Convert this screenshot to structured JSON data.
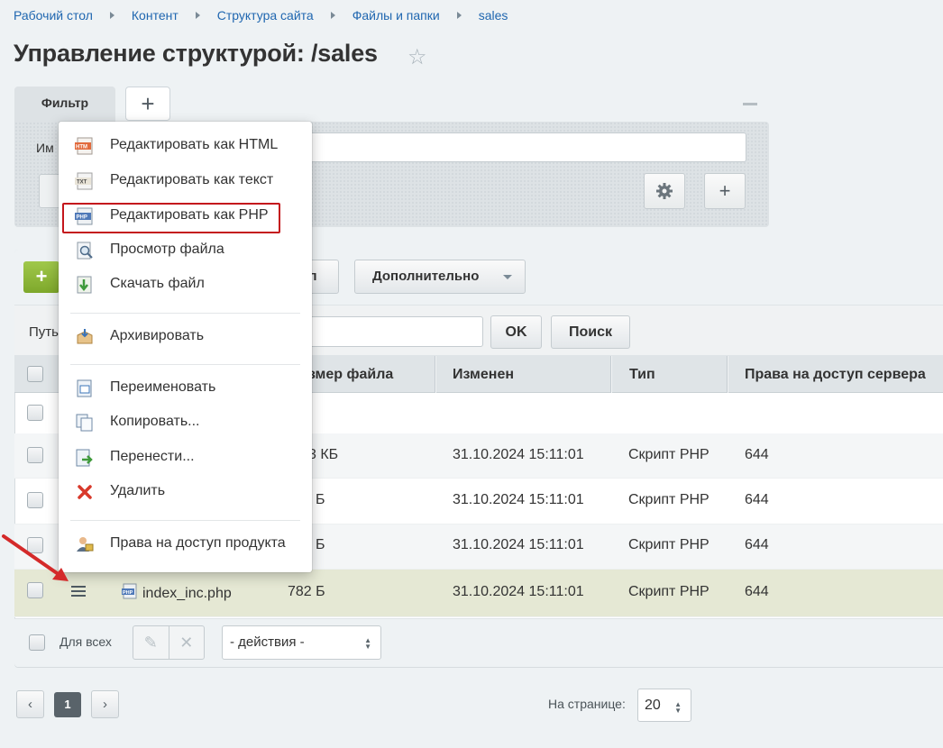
{
  "breadcrumb": [
    "Рабочий стол",
    "Контент",
    "Структура сайта",
    "Файлы и папки",
    "sales"
  ],
  "page_title": "Управление структурой: /sales",
  "filter": {
    "tab_label": "Фильтр",
    "field_label_partial": "Им"
  },
  "toolbar": {
    "add_symbol": "+",
    "hidden_button_partial": "л",
    "extra_button": "Дополнительно"
  },
  "path_bar": {
    "label_partial": "Путь",
    "ok": "OK",
    "search": "Поиск"
  },
  "columns": {
    "size_partial": "змер файла",
    "modified": "Изменен",
    "type": "Тип",
    "rights": "Права на доступ сервера"
  },
  "rows": [
    {
      "size": "3 КБ",
      "modified": "31.10.2024 15:11:01",
      "type": "Скрипт PHP",
      "rights": "644"
    },
    {
      "size": "Б",
      "modified": "31.10.2024 15:11:01",
      "type": "Скрипт PHP",
      "rights": "644"
    },
    {
      "size": "Б",
      "modified": "31.10.2024 15:11:01",
      "type": "Скрипт PHP",
      "rights": "644"
    },
    {
      "name": "index_inc.php",
      "size": "782 Б",
      "modified": "31.10.2024 15:11:01",
      "type": "Скрипт PHP",
      "rights": "644"
    }
  ],
  "footer": {
    "for_all": "Для всех",
    "actions_placeholder": "- действия -"
  },
  "pagination": {
    "current": "1",
    "per_page_label": "На странице:",
    "per_page": "20"
  },
  "context_menu": {
    "items": [
      {
        "label": "Редактировать как HTML",
        "icon": "html-file-icon"
      },
      {
        "label": "Редактировать как текст",
        "icon": "txt-file-icon"
      },
      {
        "label": "Редактировать как PHP",
        "icon": "php-file-icon",
        "highlighted": true
      },
      {
        "label": "Просмотр файла",
        "icon": "view-file-icon"
      },
      {
        "label": "Скачать файл",
        "icon": "download-icon"
      },
      {
        "label": "Архивировать",
        "icon": "archive-icon"
      },
      {
        "label": "Переименовать",
        "icon": "rename-icon"
      },
      {
        "label": "Копировать...",
        "icon": "copy-icon"
      },
      {
        "label": "Перенести...",
        "icon": "move-icon"
      },
      {
        "label": "Удалить",
        "icon": "delete-icon"
      },
      {
        "label": "Права на доступ продукта",
        "icon": "access-rights-icon"
      }
    ]
  },
  "colors": {
    "link": "#2067b0",
    "highlight_border": "#c4161c",
    "selected_row": "#e5e8d4",
    "arrow": "#d42a2a",
    "add_green": "#8cb83a"
  }
}
